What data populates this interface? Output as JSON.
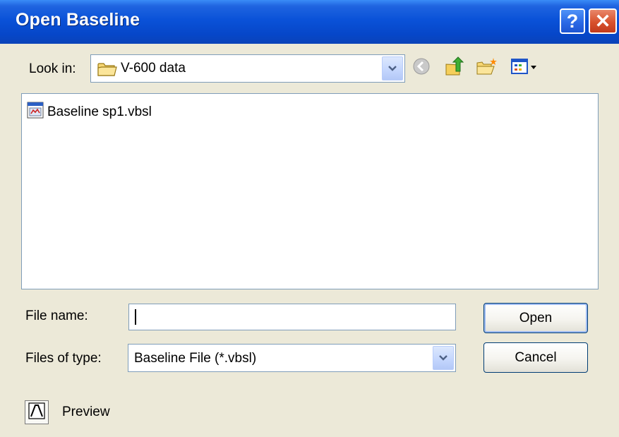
{
  "window": {
    "title": "Open Baseline"
  },
  "titlebar": {
    "help_symbol": "?",
    "close_symbol": "✕"
  },
  "look_in": {
    "label": "Look in:",
    "value": "V-600 data",
    "icon": "folder-icon"
  },
  "toolbar": {
    "items": [
      {
        "name": "back",
        "icon": "back-arrow-icon"
      },
      {
        "name": "up-one-level",
        "icon": "folder-up-icon"
      },
      {
        "name": "create-new-folder",
        "icon": "new-folder-icon"
      },
      {
        "name": "view-menu",
        "icon": "view-menu-icon"
      }
    ]
  },
  "file_list": {
    "items": [
      {
        "name": "Baseline sp1.vbsl",
        "icon": "baseline-file-icon"
      }
    ]
  },
  "file_name": {
    "label": "File name:",
    "value": "",
    "placeholder": ""
  },
  "files_of_type": {
    "label": "Files of type:",
    "value": "Baseline File (*.vbsl)"
  },
  "buttons": {
    "open": "Open",
    "cancel": "Cancel"
  },
  "preview": {
    "label": "Preview",
    "icon": "preview-peak-icon"
  },
  "colors": {
    "titlebar": "#0a52d8",
    "dialog_bg": "#ece9d8",
    "close_button": "#d8512c",
    "field_border": "#7f9db9"
  }
}
